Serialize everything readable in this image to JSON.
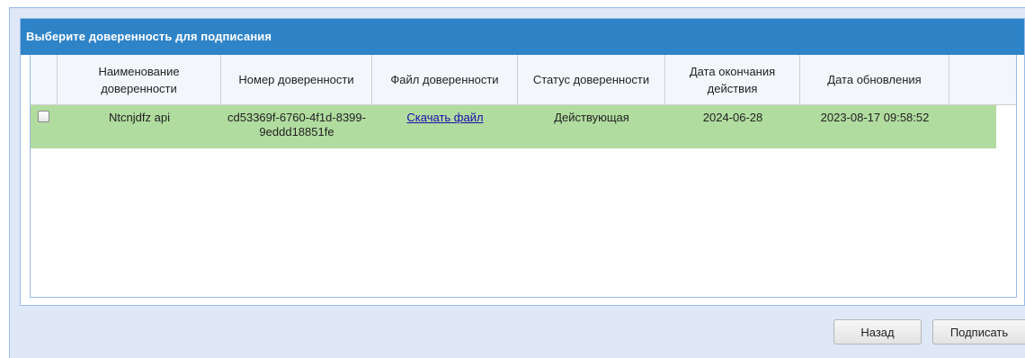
{
  "dialog": {
    "title": "Выберите доверенность для подписания"
  },
  "grid": {
    "headers": [
      "Наименование доверенности",
      "Номер доверенности",
      "Файл доверенности",
      "Статус доверенности",
      "Дата окончания действия",
      "Дата обновления"
    ],
    "rows": [
      {
        "checked": false,
        "name": "Ntcnjdfz api",
        "number": "cd53369f-6760-4f1d-8399-9eddd18851fe",
        "file_link": "Скачать файл",
        "status": "Действующая",
        "end_date": "2024-06-28",
        "updated": "2023-08-17 09:58:52",
        "highlight_color": "#b1dc9f"
      }
    ]
  },
  "buttons": {
    "back_label": "Назад",
    "sign_label": "Подписать"
  },
  "colors": {
    "header_bg": "#2f84c8",
    "window_bg": "#dfe8f6",
    "link": "#1a0dab"
  }
}
